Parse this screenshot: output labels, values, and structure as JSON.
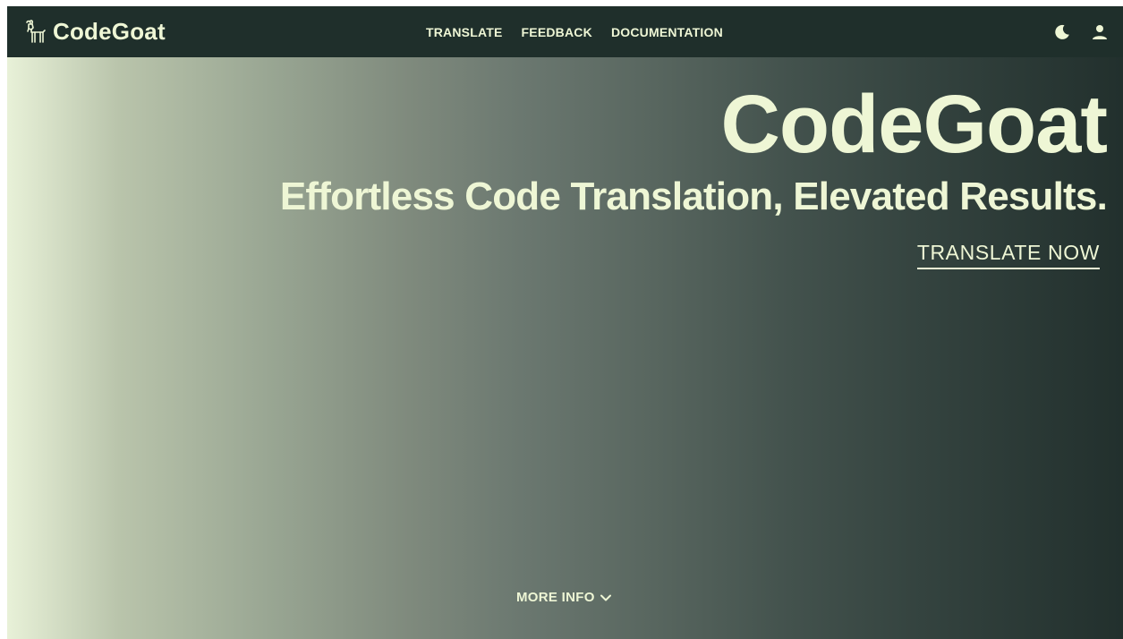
{
  "brand": {
    "name": "CodeGoat",
    "logo_icon": "goat-icon"
  },
  "nav": {
    "links": [
      {
        "label": "TRANSLATE"
      },
      {
        "label": "FEEDBACK"
      },
      {
        "label": "DOCUMENTATION"
      }
    ],
    "theme_toggle_icon": "moon-icon",
    "account_icon": "user-icon"
  },
  "hero": {
    "title": "CodeGoat",
    "subtitle": "Effortless Code Translation, Elevated Results.",
    "cta_label": "TRANSLATE NOW",
    "more_info_label": "MORE INFO",
    "more_info_icon": "chevron-down-icon"
  },
  "colors": {
    "navbar_bg": "#1f2f2b",
    "text_accent": "#eef6d5",
    "gradient_start": "#e8f1d8",
    "gradient_end": "#22302d"
  }
}
